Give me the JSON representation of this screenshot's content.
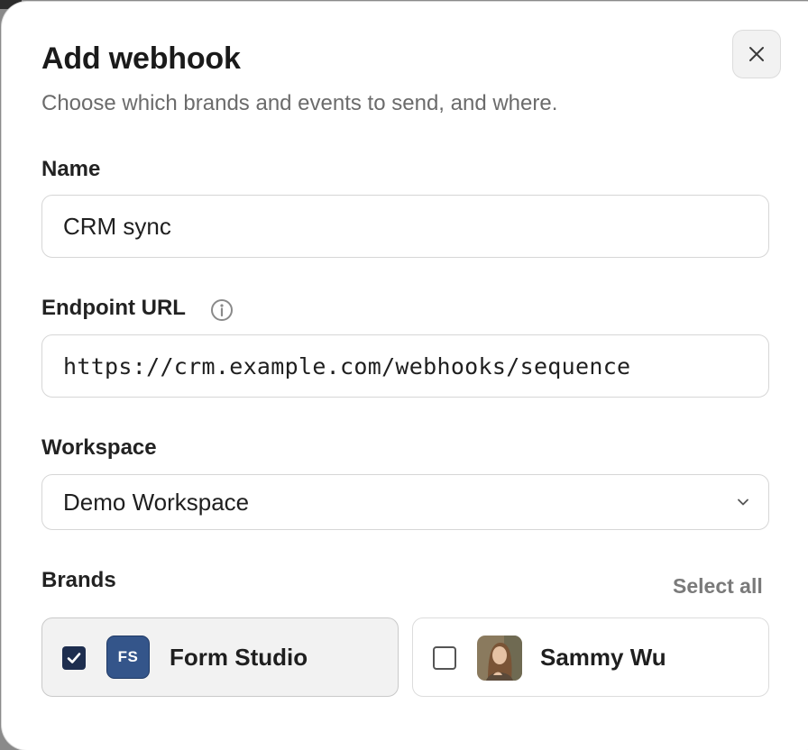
{
  "dialog": {
    "title": "Add webhook",
    "subtitle": "Choose which brands and events to send, and where.",
    "close_icon": "close-icon"
  },
  "form": {
    "name": {
      "label": "Name",
      "value": "CRM sync"
    },
    "endpoint": {
      "label": "Endpoint URL",
      "value": "https://crm.example.com/webhooks/sequence",
      "info_icon": "info-icon"
    },
    "workspace": {
      "label": "Workspace",
      "value": "Demo Workspace"
    }
  },
  "brands": {
    "label": "Brands",
    "select_all_label": "Select all",
    "items": [
      {
        "initials": "FS",
        "name": "Form Studio",
        "checked": true
      },
      {
        "initials": "",
        "name": "Sammy Wu",
        "checked": false
      }
    ]
  },
  "colors": {
    "checkbox_checked": "#1e2e4f",
    "brand_badge": "#34558a"
  }
}
